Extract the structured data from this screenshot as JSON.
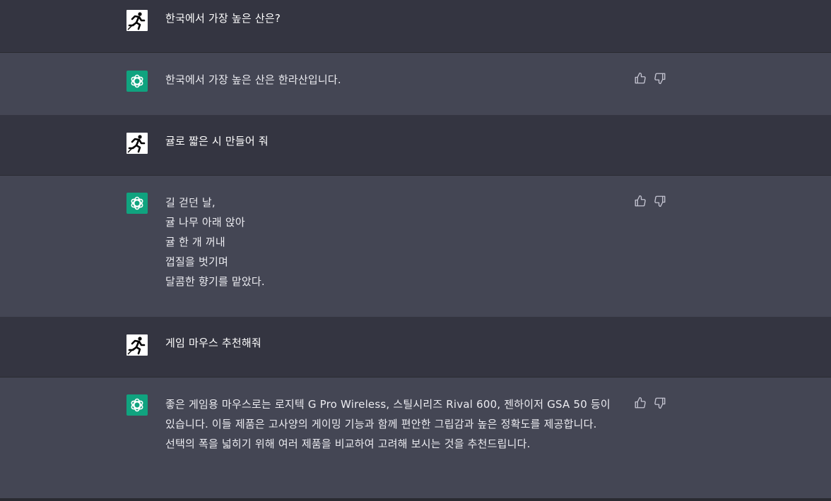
{
  "colors": {
    "user_bg": "#343541",
    "assistant_bg": "#444654",
    "gpt_green": "#10a37f"
  },
  "messages": [
    {
      "role": "user",
      "avatar_icon": "runner-icon",
      "text": "한국에서 가장 높은 산은?"
    },
    {
      "role": "assistant",
      "avatar_icon": "openai-logo-icon",
      "text": "한국에서 가장 높은 산은 한라산입니다."
    },
    {
      "role": "user",
      "avatar_icon": "runner-icon",
      "text": "귤로 짧은 시 만들어 줘"
    },
    {
      "role": "assistant",
      "avatar_icon": "openai-logo-icon",
      "lines": [
        "길 걷던 날,",
        "귤 나무 아래 앉아",
        "귤 한 개 꺼내",
        "껍질을 벗기며",
        "달콤한 향기를 맡았다."
      ]
    },
    {
      "role": "user",
      "avatar_icon": "runner-icon",
      "text": "게임 마우스 추천해줘"
    },
    {
      "role": "assistant",
      "avatar_icon": "openai-logo-icon",
      "text": "좋은 게임용 마우스로는 로지텍 G Pro Wireless, 스틸시리즈 Rival 600, 젠하이저 GSA 50 등이 있습니다. 이들 제품은 고사양의 게이밍 기능과 함께 편안한 그립감과 높은 정확도를 제공합니다. 선택의 폭을 넓히기 위해 여러 제품을 비교하여 고려해 보시는 것을 추천드립니다."
    }
  ],
  "actions": {
    "thumbs_up_icon": "thumbs-up-icon",
    "thumbs_down_icon": "thumbs-down-icon"
  }
}
